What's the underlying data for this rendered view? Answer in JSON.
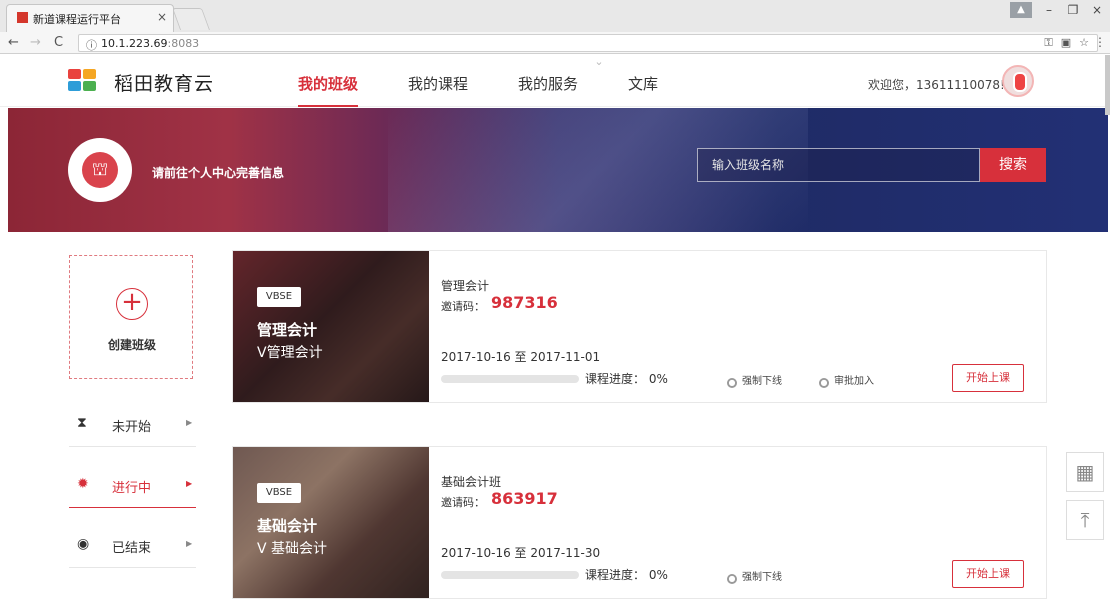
{
  "browser": {
    "tab_title": "新道课程运行平台",
    "tab_close": "×",
    "url_host": "10.1.223.69",
    "url_port": ":8083"
  },
  "header": {
    "logo_text": "稻田教育云",
    "nav": [
      "我的班级",
      "我的课程",
      "我的服务",
      "文库"
    ],
    "active_nav": "我的班级",
    "welcome": "欢迎您，13611110078!"
  },
  "banner": {
    "profile_prompt": "请前往个人中心完善信息",
    "search_placeholder": "输入班级名称",
    "search_button": "搜索"
  },
  "sidebar": {
    "create_label": "创建班级",
    "statuses": [
      {
        "label": "未开始",
        "icon": "hourglass-icon"
      },
      {
        "label": "进行中",
        "icon": "sun-icon"
      },
      {
        "label": "已结束",
        "icon": "circle-icon"
      }
    ],
    "active_status": "进行中"
  },
  "classes": [
    {
      "tag": "VBSE",
      "thumb_title": "管理会计",
      "thumb_subtitle": "V管理会计",
      "name": "管理会计",
      "invite_label": "邀请码：",
      "invite_code": "987316",
      "date_range": "2017-10-16 至 2017-11-01",
      "progress_label": "课程进度：",
      "progress_percent": "0%",
      "progress": 0,
      "actions": [
        "强制下线",
        "审批加入"
      ],
      "start_button": "开始上课"
    },
    {
      "tag": "VBSE",
      "thumb_title": "基础会计",
      "thumb_subtitle": "V 基础会计",
      "name": "基础会计班",
      "invite_label": "邀请码：",
      "invite_code": "863917",
      "date_range": "2017-10-16 至 2017-11-30",
      "progress_label": "课程进度：",
      "progress_percent": "0%",
      "progress": 0,
      "actions": [
        "强制下线"
      ],
      "start_button": "开始上课"
    }
  ],
  "colors": {
    "accent": "#d7303b",
    "banner_left": "#8c2636",
    "banner_right": "#223075"
  }
}
